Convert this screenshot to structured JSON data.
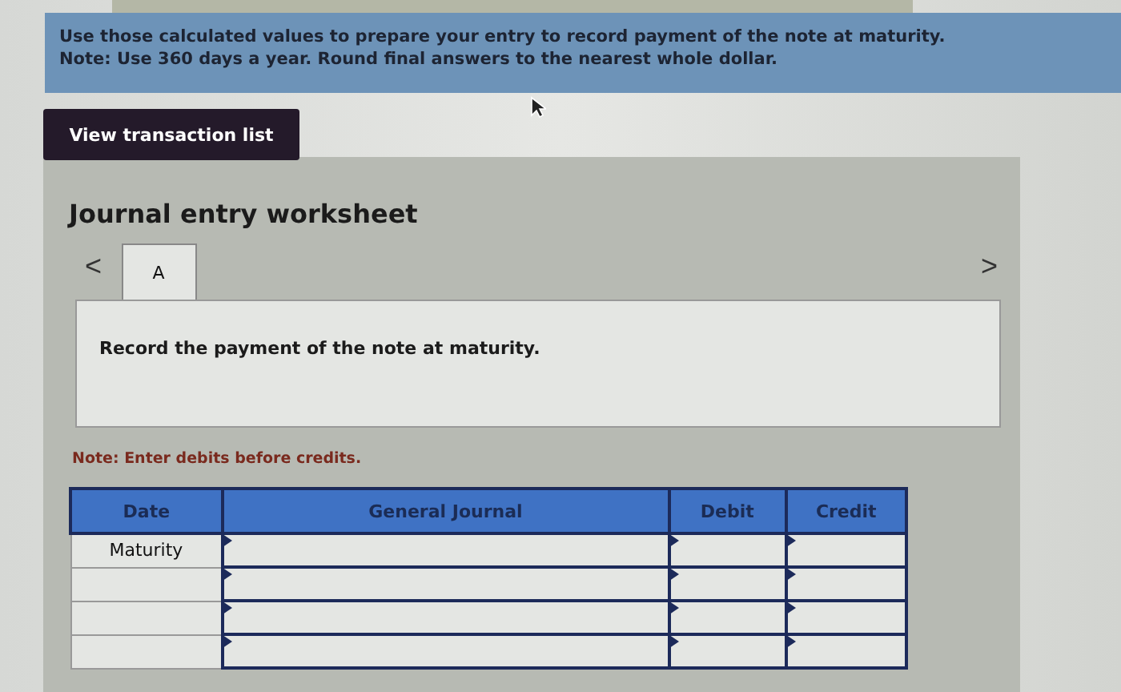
{
  "instructions": {
    "line_1": "Use those calculated values to prepare your entry to record payment of the note at maturity.",
    "line_2": "Note: Use 360 days a year. Round final answers to the nearest whole dollar."
  },
  "view_button": "View transaction list",
  "worksheet": {
    "title": "Journal entry worksheet",
    "prev": "<",
    "next": ">",
    "tabs": [
      {
        "label": "A",
        "selected": true
      }
    ],
    "prompt": "Record the payment of the note at maturity.",
    "note": "Note: Enter debits before credits.",
    "columns": [
      "Date",
      "General Journal",
      "Debit",
      "Credit"
    ],
    "rows": [
      {
        "date": "Maturity"
      },
      {},
      {},
      {}
    ]
  }
}
